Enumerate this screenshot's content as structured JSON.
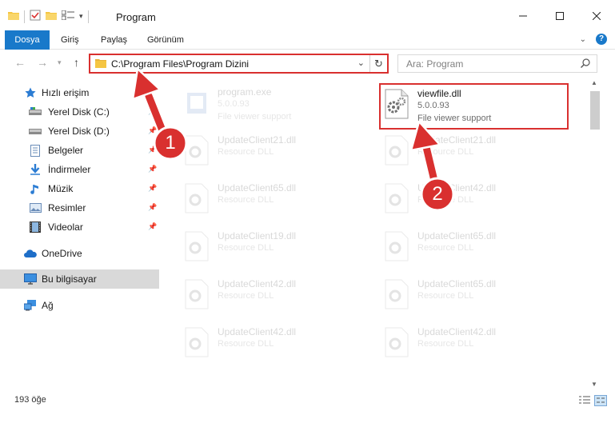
{
  "window": {
    "title": "Program"
  },
  "ribbon": {
    "tabs": [
      "Dosya",
      "Giriş",
      "Paylaş",
      "Görünüm"
    ]
  },
  "address": {
    "path": "C:\\Program Files\\Program Dizini"
  },
  "search": {
    "placeholder": "Ara: Program"
  },
  "sidebar": {
    "items": [
      {
        "label": "Hızlı erişim",
        "icon": "star-icon"
      },
      {
        "label": "Yerel Disk (C:)",
        "icon": "drive-icon"
      },
      {
        "label": "Yerel Disk (D:)",
        "icon": "drive-icon"
      },
      {
        "label": "Belgeler",
        "icon": "documents-icon"
      },
      {
        "label": "İndirmeler",
        "icon": "download-icon"
      },
      {
        "label": "Müzik",
        "icon": "music-icon"
      },
      {
        "label": "Resimler",
        "icon": "pictures-icon"
      },
      {
        "label": "Videolar",
        "icon": "videos-icon"
      },
      {
        "label": "OneDrive",
        "icon": "cloud-icon"
      },
      {
        "label": "Bu bilgisayar",
        "icon": "computer-icon"
      },
      {
        "label": "Ağ",
        "icon": "network-icon"
      }
    ]
  },
  "files": {
    "col1": [
      {
        "name": "program.exe",
        "line2": "5.0.0.93",
        "line3": "File viewer support"
      },
      {
        "name": "UpdateClient21.dll",
        "line2": "Resource DLL"
      },
      {
        "name": "UpdateClient65.dll",
        "line2": "Resource DLL"
      },
      {
        "name": "UpdateClient19.dll",
        "line2": "Resource DLL"
      },
      {
        "name": "UpdateClient42.dll",
        "line2": "Resource DLL"
      },
      {
        "name": "UpdateClient42.dll",
        "line2": "Resource DLL"
      }
    ],
    "col2": [
      {
        "name": "viewfile.dll",
        "line2": "5.0.0.93",
        "line3": "File viewer support"
      },
      {
        "name": "UpdateClient21.dll",
        "line2": "Resource DLL"
      },
      {
        "name": "UpdateClient42.dll",
        "line2": "Resource DLL"
      },
      {
        "name": "UpdateClient65.dll",
        "line2": "Resource DLL"
      },
      {
        "name": "UpdateClient65.dll",
        "line2": "Resource DLL"
      },
      {
        "name": "UpdateClient42.dll",
        "line2": "Resource DLL"
      }
    ]
  },
  "status": {
    "count": "193 öğe"
  },
  "callouts": {
    "one": "1",
    "two": "2"
  },
  "colors": {
    "accent": "#1979ca",
    "callout": "#d9302f"
  }
}
